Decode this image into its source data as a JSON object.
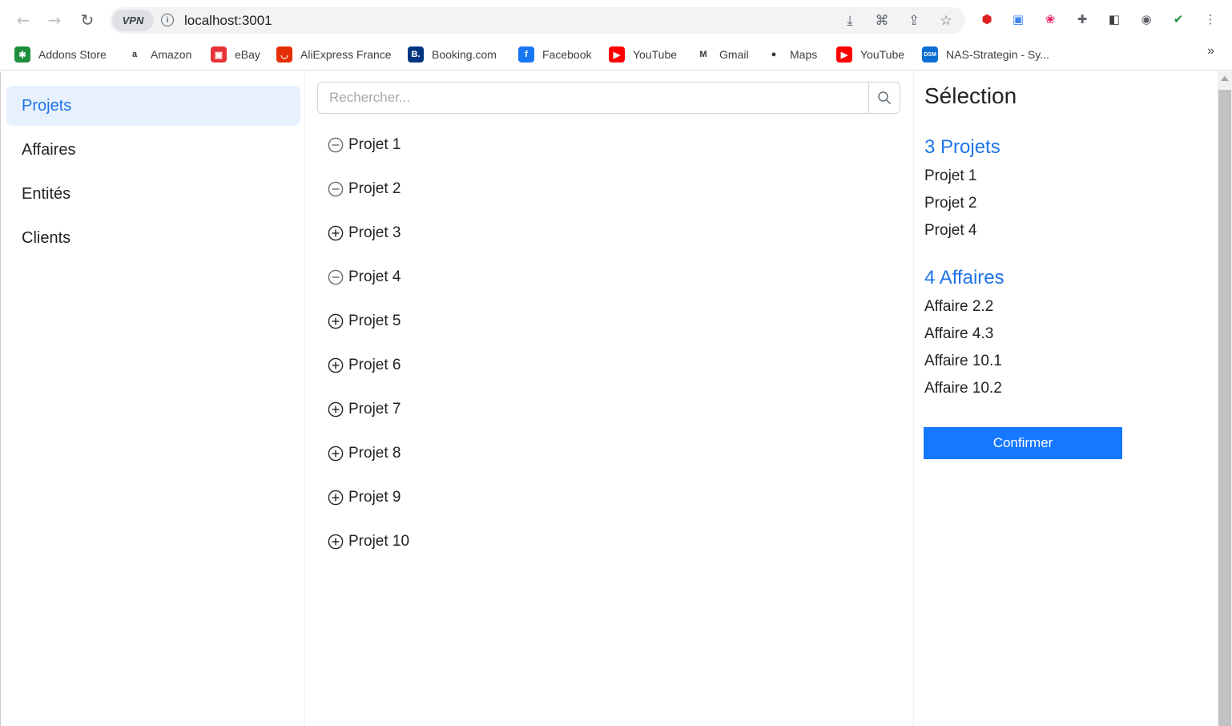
{
  "browser": {
    "url": "localhost:3001",
    "vpn_label": "VPN",
    "bookmarks": [
      {
        "label": "Addons Store",
        "icon": "addons-store-icon",
        "color": "#1e8e3e",
        "glyph": "✱"
      },
      {
        "label": "Amazon",
        "icon": "amazon-icon",
        "color": "#ffffff",
        "glyph": "a"
      },
      {
        "label": "eBay",
        "icon": "ebay-icon",
        "color": "#e53238",
        "glyph": "▣"
      },
      {
        "label": "AliExpress France",
        "icon": "aliexpress-icon",
        "color": "#e62e04",
        "glyph": "◡"
      },
      {
        "label": "Booking.com",
        "icon": "booking-icon",
        "color": "#003580",
        "glyph": "B."
      },
      {
        "label": "Facebook",
        "icon": "facebook-icon",
        "color": "#1877f2",
        "glyph": "f"
      },
      {
        "label": "YouTube",
        "icon": "youtube-icon",
        "color": "#ff0000",
        "glyph": "▶"
      },
      {
        "label": "Gmail",
        "icon": "gmail-icon",
        "color": "#ffffff",
        "glyph": "M"
      },
      {
        "label": "Maps",
        "icon": "maps-icon",
        "color": "#ffffff",
        "glyph": "●"
      },
      {
        "label": "YouTube",
        "icon": "youtube-icon",
        "color": "#ff0000",
        "glyph": "▶"
      },
      {
        "label": "NAS-Strategin - Sy...",
        "icon": "dsm-icon",
        "color": "#0a6ed1",
        "glyph": "DSM"
      }
    ],
    "more_label": "»"
  },
  "sidebar": {
    "items": [
      {
        "label": "Projets",
        "active": true
      },
      {
        "label": "Affaires",
        "active": false
      },
      {
        "label": "Entités",
        "active": false
      },
      {
        "label": "Clients",
        "active": false
      }
    ]
  },
  "search": {
    "placeholder": "Rechercher..."
  },
  "projects": [
    {
      "label": "Projet 1",
      "selected": true
    },
    {
      "label": "Projet 2",
      "selected": true
    },
    {
      "label": "Projet 3",
      "selected": false
    },
    {
      "label": "Projet 4",
      "selected": true
    },
    {
      "label": "Projet 5",
      "selected": false
    },
    {
      "label": "Projet 6",
      "selected": false
    },
    {
      "label": "Projet 7",
      "selected": false
    },
    {
      "label": "Projet 8",
      "selected": false
    },
    {
      "label": "Projet 9",
      "selected": false
    },
    {
      "label": "Projet 10",
      "selected": false
    }
  ],
  "selection": {
    "title": "Sélection",
    "projects_title": "3 Projets",
    "projects": [
      "Projet 1",
      "Projet 2",
      "Projet 4"
    ],
    "affaires_title": "4 Affaires",
    "affaires": [
      "Affaire 2.2",
      "Affaire 4.3",
      "Affaire 10.1",
      "Affaire 10.2"
    ],
    "confirm_label": "Confirmer"
  },
  "colors": {
    "accent": "#1e74e8",
    "button": "#1677ff",
    "active_bg": "#e7f1fe"
  }
}
